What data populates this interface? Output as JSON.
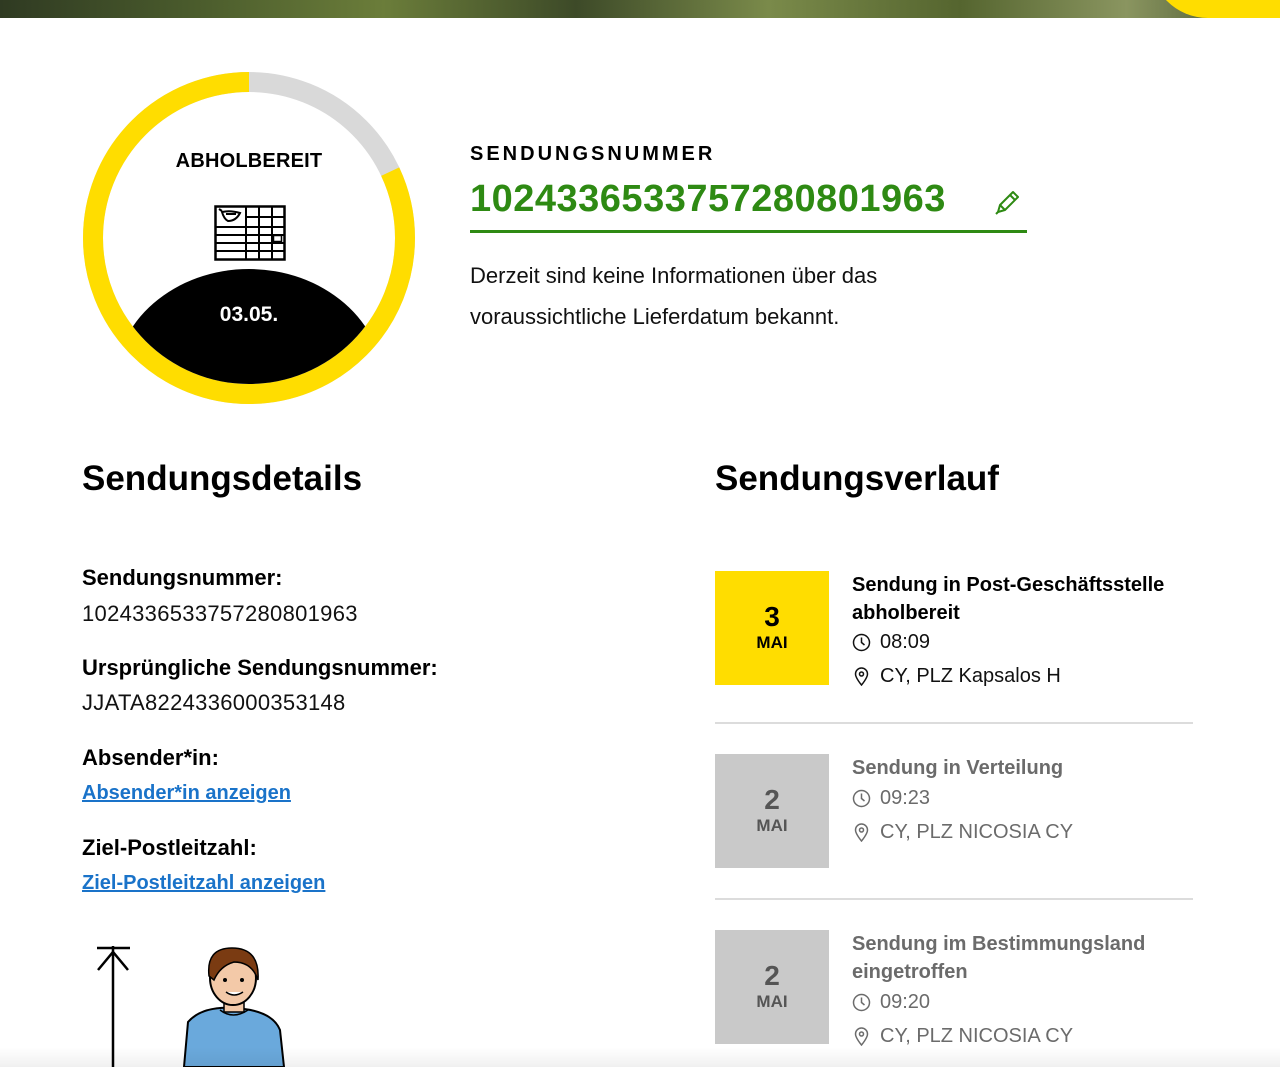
{
  "status": {
    "label": "ABHOLBEREIT",
    "date": "03.05.",
    "progress_fraction": 0.82,
    "icon": "parcel-locker-icon",
    "ring_color": "#ffdd00",
    "track_color": "#d9d9d9"
  },
  "shipment": {
    "caption": "SENDUNGSNUMMER",
    "number": "1024336533757280801963",
    "info": "Derzeit sind keine Informationen über das voraussichtliche Lieferdatum bekannt.",
    "accent_color": "#2e8a13"
  },
  "details": {
    "title": "Sendungsdetails",
    "number_label": "Sendungsnummer:",
    "number_value": "1024336533757280801963",
    "original_label": "Ursprüngliche Sendungsnummer:",
    "original_value": "JJATA8224336000353148",
    "sender_label": "Absender*in:",
    "sender_link": "Absender*in anzeigen",
    "zip_label": "Ziel-Postleitzahl:",
    "zip_link": "Ziel-Postleitzahl anzeigen"
  },
  "history": {
    "title": "Sendungsverlauf",
    "events": [
      {
        "day": "3",
        "month": "MAI",
        "title": "Sendung in Post-Geschäftsstelle abholbereit",
        "time": "08:09",
        "location": "CY, PLZ Kapsalos H",
        "state": "active"
      },
      {
        "day": "2",
        "month": "MAI",
        "title": "Sendung in Verteilung",
        "time": "09:23",
        "location": "CY, PLZ NICOSIA CY",
        "state": "past"
      },
      {
        "day": "2",
        "month": "MAI",
        "title": "Sendung im Bestimmungsland eingetroffen",
        "time": "09:20",
        "location": "CY, PLZ NICOSIA CY",
        "state": "past"
      }
    ]
  },
  "colors": {
    "brand_yellow": "#ffdd00",
    "link_blue": "#1a73c9",
    "inactive_gray": "#c9c9c9"
  }
}
